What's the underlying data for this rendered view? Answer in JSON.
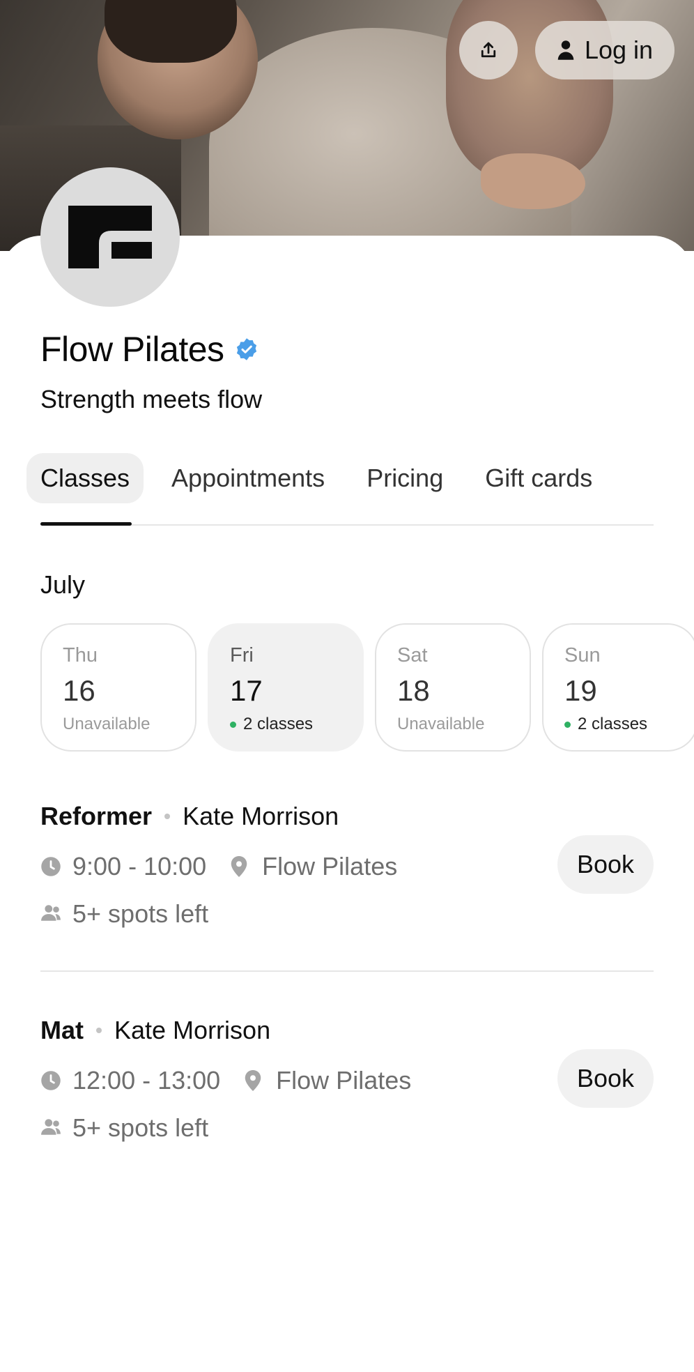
{
  "header": {
    "login_label": "Log in",
    "share_icon": "share-upload-icon",
    "user_icon": "person-icon"
  },
  "business": {
    "name": "Flow Pilates",
    "tagline": "Strength meets flow",
    "verified": true,
    "verified_color": "#4a9ee8"
  },
  "tabs": [
    {
      "label": "Classes",
      "active": true
    },
    {
      "label": "Appointments",
      "active": false
    },
    {
      "label": "Pricing",
      "active": false
    },
    {
      "label": "Gift cards",
      "active": false
    }
  ],
  "calendar": {
    "month": "July",
    "days": [
      {
        "weekday": "Thu",
        "date": "16",
        "status": "Unavailable",
        "has_classes": false,
        "selected": false
      },
      {
        "weekday": "Fri",
        "date": "17",
        "status": "2 classes",
        "has_classes": true,
        "selected": true
      },
      {
        "weekday": "Sat",
        "date": "18",
        "status": "Unavailable",
        "has_classes": false,
        "selected": false
      },
      {
        "weekday": "Sun",
        "date": "19",
        "status": "2 classes",
        "has_classes": true,
        "selected": false
      }
    ],
    "available_dot_color": "#2fb163"
  },
  "classes": [
    {
      "type": "Reformer",
      "instructor": "Kate Morrison",
      "time": "9:00 - 10:00",
      "location": "Flow Pilates",
      "spots": "5+ spots left",
      "book_label": "Book"
    },
    {
      "type": "Mat",
      "instructor": "Kate Morrison",
      "time": "12:00 - 13:00",
      "location": "Flow Pilates",
      "spots": "5+ spots left",
      "book_label": "Book"
    }
  ]
}
